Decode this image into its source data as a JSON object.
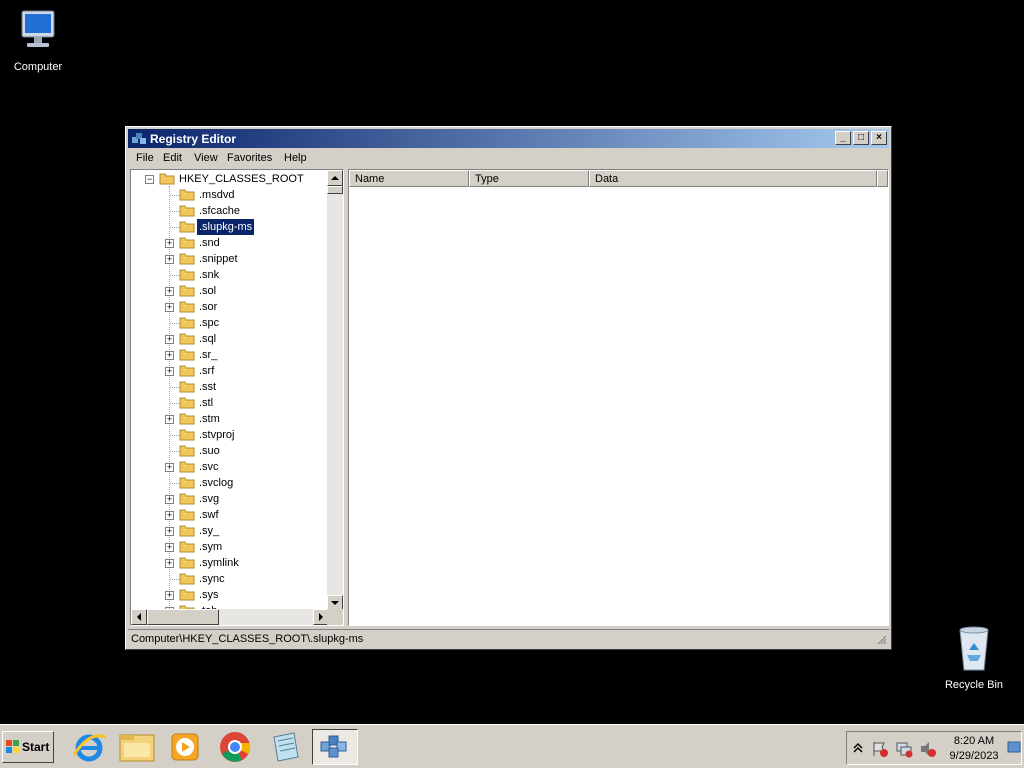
{
  "desktop": {
    "computer_label": "Computer",
    "recycle_label": "Recycle Bin"
  },
  "window": {
    "title": "Registry Editor",
    "minimize": "_",
    "maximize": "□",
    "close": "×",
    "menu": [
      "File",
      "Edit",
      "View",
      "Favorites",
      "Help"
    ],
    "tree": {
      "root": "HKEY_CLASSES_ROOT",
      "items": [
        {
          "label": ".msdvd",
          "expandable": false
        },
        {
          "label": ".sfcache",
          "expandable": false
        },
        {
          "label": ".slupkg-ms",
          "expandable": false,
          "selected": true
        },
        {
          "label": ".snd",
          "expandable": true
        },
        {
          "label": ".snippet",
          "expandable": true
        },
        {
          "label": ".snk",
          "expandable": false
        },
        {
          "label": ".sol",
          "expandable": true
        },
        {
          "label": ".sor",
          "expandable": true
        },
        {
          "label": ".spc",
          "expandable": false
        },
        {
          "label": ".sql",
          "expandable": true
        },
        {
          "label": ".sr_",
          "expandable": true
        },
        {
          "label": ".srf",
          "expandable": true
        },
        {
          "label": ".sst",
          "expandable": false
        },
        {
          "label": ".stl",
          "expandable": false
        },
        {
          "label": ".stm",
          "expandable": true
        },
        {
          "label": ".stvproj",
          "expandable": false
        },
        {
          "label": ".suo",
          "expandable": false
        },
        {
          "label": ".svc",
          "expandable": true
        },
        {
          "label": ".svclog",
          "expandable": false
        },
        {
          "label": ".svg",
          "expandable": true
        },
        {
          "label": ".swf",
          "expandable": true
        },
        {
          "label": ".sy_",
          "expandable": true
        },
        {
          "label": ".sym",
          "expandable": true
        },
        {
          "label": ".symlink",
          "expandable": true
        },
        {
          "label": ".sync",
          "expandable": false
        },
        {
          "label": ".sys",
          "expandable": true
        },
        {
          "label": ".tab",
          "expandable": true
        }
      ]
    },
    "columns": [
      "Name",
      "Type",
      "Data"
    ],
    "status": "Computer\\HKEY_CLASSES_ROOT\\.slupkg-ms"
  },
  "taskbar": {
    "start_label": "Start",
    "apps": [
      "internet-explorer-icon",
      "file-explorer-icon",
      "media-player-icon",
      "chrome-icon",
      "notepad-icon",
      "regedit-icon"
    ],
    "time": "8:20 AM",
    "date": "9/29/2023"
  }
}
